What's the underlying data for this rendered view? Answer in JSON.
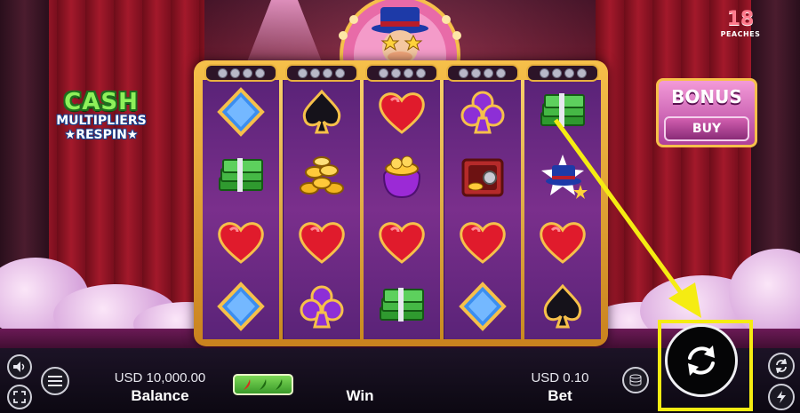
{
  "brand": {
    "number": "18",
    "name": "PEACHES"
  },
  "logo": {
    "line1": "CASH",
    "line2": "MULTIPLIERS",
    "line3": "★RESPIN★"
  },
  "bonus": {
    "title": "BONUS",
    "button": "BUY"
  },
  "reels": {
    "columns": [
      [
        "diamond",
        "cash-stack",
        "heart",
        "diamond"
      ],
      [
        "spade",
        "gold-coins",
        "heart",
        "club"
      ],
      [
        "heart",
        "coin-bag",
        "heart",
        "cash-stack"
      ],
      [
        "club",
        "safe",
        "heart",
        "diamond"
      ],
      [
        "cash-stack",
        "magic-hat",
        "heart",
        "spade"
      ]
    ]
  },
  "footer": {
    "balance_value": "USD 10,000.00",
    "balance_label": "Balance",
    "win_label": "Win",
    "bet_value": "USD 0.10",
    "bet_label": "Bet"
  },
  "icons": {
    "sound": "speaker-icon",
    "fullscreen": "fullscreen-icon",
    "menu": "menu-icon",
    "spin": "spin-icon",
    "autoplay": "autoplay-icon",
    "turbo": "lightning-icon",
    "stake": "coin-stack-icon"
  },
  "annotation": {
    "color": "#f5ec12"
  }
}
